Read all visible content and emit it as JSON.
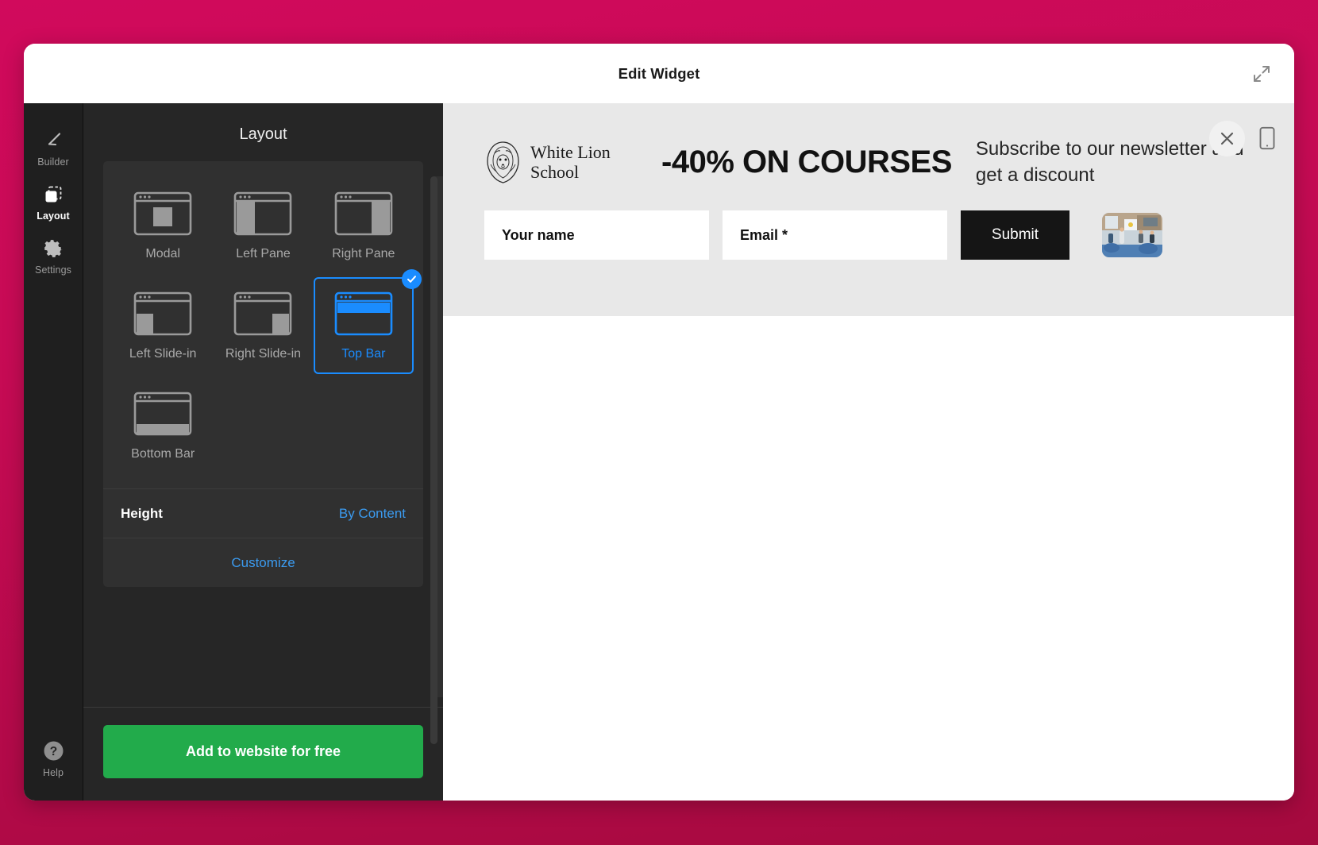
{
  "window": {
    "title": "Edit Widget",
    "expand_icon": "expand-arrows-icon"
  },
  "rail": {
    "items": [
      {
        "label": "Builder",
        "icon": "pencil-icon",
        "active": false
      },
      {
        "label": "Layout",
        "icon": "layout-icon",
        "active": true
      },
      {
        "label": "Settings",
        "icon": "gear-icon",
        "active": false
      }
    ],
    "help": {
      "label": "Help",
      "icon": "question-mark-icon"
    }
  },
  "panel": {
    "title": "Layout",
    "layouts": [
      {
        "label": "Modal",
        "selected": false
      },
      {
        "label": "Left Pane",
        "selected": false
      },
      {
        "label": "Right Pane",
        "selected": false
      },
      {
        "label": "Left Slide-in",
        "selected": false
      },
      {
        "label": "Right Slide-in",
        "selected": false
      },
      {
        "label": "Top Bar",
        "selected": true
      },
      {
        "label": "Bottom Bar",
        "selected": false
      }
    ],
    "height_row": {
      "label": "Height",
      "value": "By Content"
    },
    "customize_label": "Customize",
    "cta_label": "Add to website for free"
  },
  "preview": {
    "brand": {
      "line1": "White Lion",
      "line2": "School",
      "logo_icon": "lion-head-logo-icon"
    },
    "headline": "-40% ON COURSES",
    "subtext": "Subscribe to our newsletter and get a discount",
    "fields": [
      {
        "name": "your-name",
        "placeholder": "Your name",
        "value": ""
      },
      {
        "name": "email",
        "placeholder": "Email *",
        "value": ""
      }
    ],
    "submit_label": "Submit",
    "thumbnail_alt": "classroom-photo",
    "close_icon": "close-icon",
    "mobile_icon": "mobile-phone-icon"
  },
  "colors": {
    "background_top": "#d10a5c",
    "background_bottom": "#a50a3e",
    "accent_blue": "#1a8cff",
    "cta_green": "#22ab4b",
    "panel_dark": "#262626",
    "rail_dark": "#1f1f1f",
    "widget_bg": "#e8e8e8",
    "submit_black": "#151515"
  }
}
